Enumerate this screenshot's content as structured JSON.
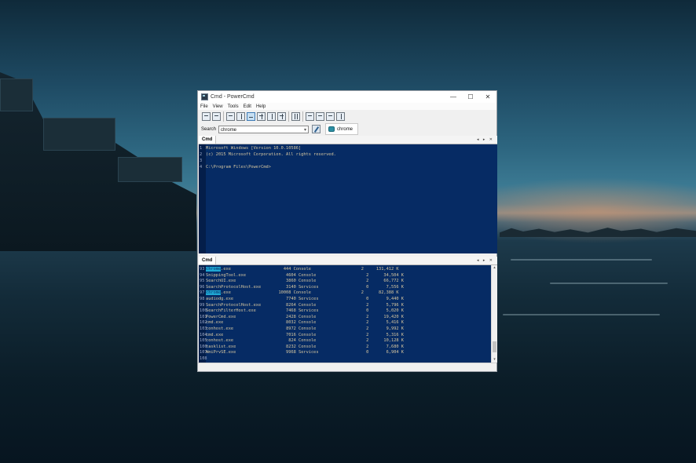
{
  "window": {
    "title": "Cmd - PowerCmd",
    "controls": {
      "minimize": "—",
      "maximize": "☐",
      "close": "✕"
    }
  },
  "menu": [
    "File",
    "View",
    "Tools",
    "Edit",
    "Help"
  ],
  "toolbar": {
    "icons": [
      "new-session-icon",
      "save-icon",
      "layout-single-icon",
      "layout-vsplit-icon",
      "layout-hsplit-icon",
      "layout-3-icon",
      "layout-4-icon",
      "layout-grid-icon",
      "pause-icon",
      "screen-icon",
      "binoculars-icon",
      "window-icon",
      "help-icon"
    ]
  },
  "search": {
    "label": "Search",
    "value": "chrome",
    "dropdown_arrow": "▾",
    "result_tab": "chrome"
  },
  "top_pane": {
    "tab": "Cmd",
    "controls": "◂ ▸ ✕",
    "lines": [
      {
        "num": "1",
        "text": "Microsoft Windows [Version 10.0.10586]"
      },
      {
        "num": "2",
        "text": "(c) 2015 Microsoft Corporation. All rights reserved."
      },
      {
        "num": "3",
        "text": ""
      },
      {
        "num": "4",
        "text": "C:\\Program Files\\PowerCmd>"
      }
    ]
  },
  "bottom_pane": {
    "tab": "Cmd",
    "controls": "◂ ▸ ✕",
    "rows": [
      {
        "num": "93",
        "image": "chrome",
        "rest": ".exe                     444 Console                    2     131,412 K",
        "highlight": true
      },
      {
        "num": "94",
        "image": "SnippingTool.exe",
        "rest": "                4604 Console                    2      34,504 K",
        "highlight": false
      },
      {
        "num": "95",
        "image": "SearchUI.exe",
        "rest": "                    3860 Console                    2      66,772 K",
        "highlight": false
      },
      {
        "num": "96",
        "image": "SearchProtocolHost.exe",
        "rest": "          3140 Services                   0       7,556 K",
        "highlight": false
      },
      {
        "num": "97",
        "image": "chrome",
        "rest": ".exe                   10008 Console                    2      82,388 K",
        "highlight": true
      },
      {
        "num": "98",
        "image": "audiodg.exe",
        "rest": "                     7740 Services                   0       9,440 K",
        "highlight": false
      },
      {
        "num": "99",
        "image": "SearchProtocolHost.exe",
        "rest": "          8264 Console                    2       5,796 K",
        "highlight": false
      },
      {
        "num": "100",
        "image": "SearchFilterHost.exe",
        "rest": "            7468 Services                   0       5,020 K",
        "highlight": false
      },
      {
        "num": "101",
        "image": "PowerCmd.exe",
        "rest": "                    2428 Console                    2      19,420 K",
        "highlight": false
      },
      {
        "num": "102",
        "image": "cmd.exe",
        "rest": "                         8032 Console                    2       5,416 K",
        "highlight": false
      },
      {
        "num": "103",
        "image": "conhost.exe",
        "rest": "                     8972 Console                    2       9,992 K",
        "highlight": false
      },
      {
        "num": "104",
        "image": "cmd.exe",
        "rest": "                         7016 Console                    2       5,316 K",
        "highlight": false
      },
      {
        "num": "105",
        "image": "conhost.exe",
        "rest": "                      824 Console                    2      10,128 K",
        "highlight": false
      },
      {
        "num": "106",
        "image": "tasklist.exe",
        "rest": "                    8232 Console                    2       7,680 K",
        "highlight": false
      },
      {
        "num": "107",
        "image": "WmiPrvSE.exe",
        "rest": "                    9968 Services                   0       6,904 K",
        "highlight": false
      },
      {
        "num": "108",
        "image": "",
        "rest": "",
        "highlight": false
      }
    ],
    "scroll": {
      "up": "▴",
      "down": "▾"
    }
  },
  "colors": {
    "console_bg": "#062b64",
    "console_text": "#d7c7a0",
    "highlight": "#1fa8d4"
  }
}
